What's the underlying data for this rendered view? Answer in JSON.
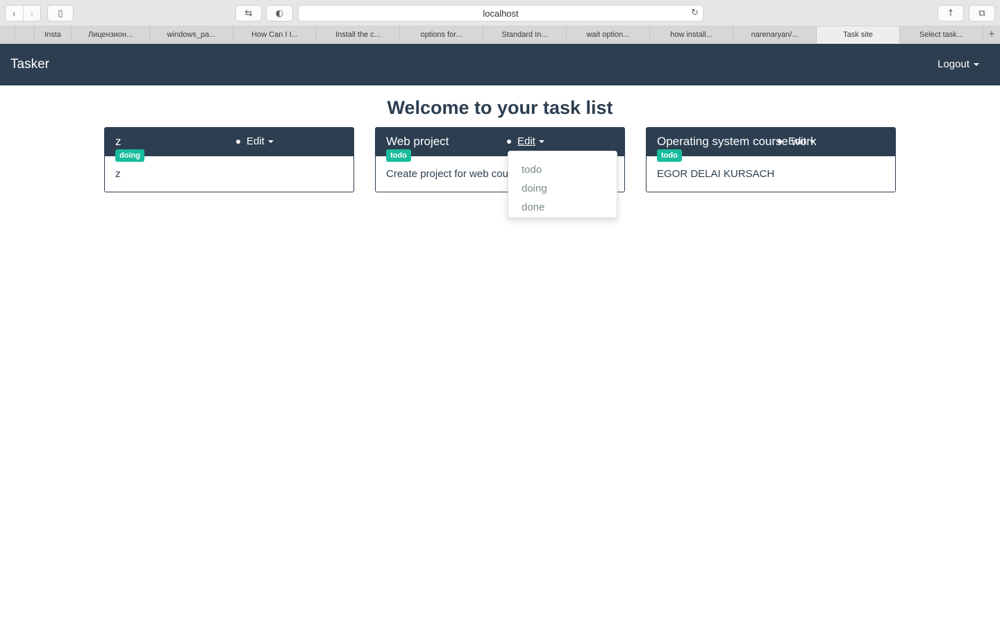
{
  "browser": {
    "url": "localhost",
    "tabs": [
      {
        "label": "",
        "width": 22,
        "active": false
      },
      {
        "label": "",
        "width": 28,
        "active": false
      },
      {
        "label": "Insta",
        "width": 53,
        "active": false
      },
      {
        "label": "Лицензион...",
        "width": 113,
        "active": false
      },
      {
        "label": "windows_pa...",
        "width": 120,
        "active": false
      },
      {
        "label": "How Can I I...",
        "width": 120,
        "active": false
      },
      {
        "label": "Install the c...",
        "width": 120,
        "active": false
      },
      {
        "label": "options for...",
        "width": 120,
        "active": false
      },
      {
        "label": "Standard In...",
        "width": 120,
        "active": false
      },
      {
        "label": "wait option...",
        "width": 120,
        "active": false
      },
      {
        "label": "how install...",
        "width": 120,
        "active": false
      },
      {
        "label": "narenaryan/...",
        "width": 120,
        "active": false
      },
      {
        "label": "Task site",
        "width": 120,
        "active": true
      },
      {
        "label": "Select task...",
        "width": 120,
        "active": false
      }
    ]
  },
  "app": {
    "brand": "Tasker",
    "logout_label": "Logout",
    "welcome": "Welcome to your task list",
    "edit_label": "Edit"
  },
  "tasks": [
    {
      "title": "z",
      "status": "doing",
      "description": "z"
    },
    {
      "title": "Web project",
      "status": "todo",
      "description": "Create project for web cou"
    },
    {
      "title": "Operating system course work",
      "status": "todo",
      "description": "EGOR DELAI KURSACH"
    }
  ],
  "status_dropdown": {
    "options": [
      "todo",
      "doing",
      "done"
    ]
  },
  "colors": {
    "navbar": "#2c3e50",
    "badge": "#18bc9c",
    "text": "#2c3e50",
    "dropdown_text": "#7b8a8b"
  }
}
